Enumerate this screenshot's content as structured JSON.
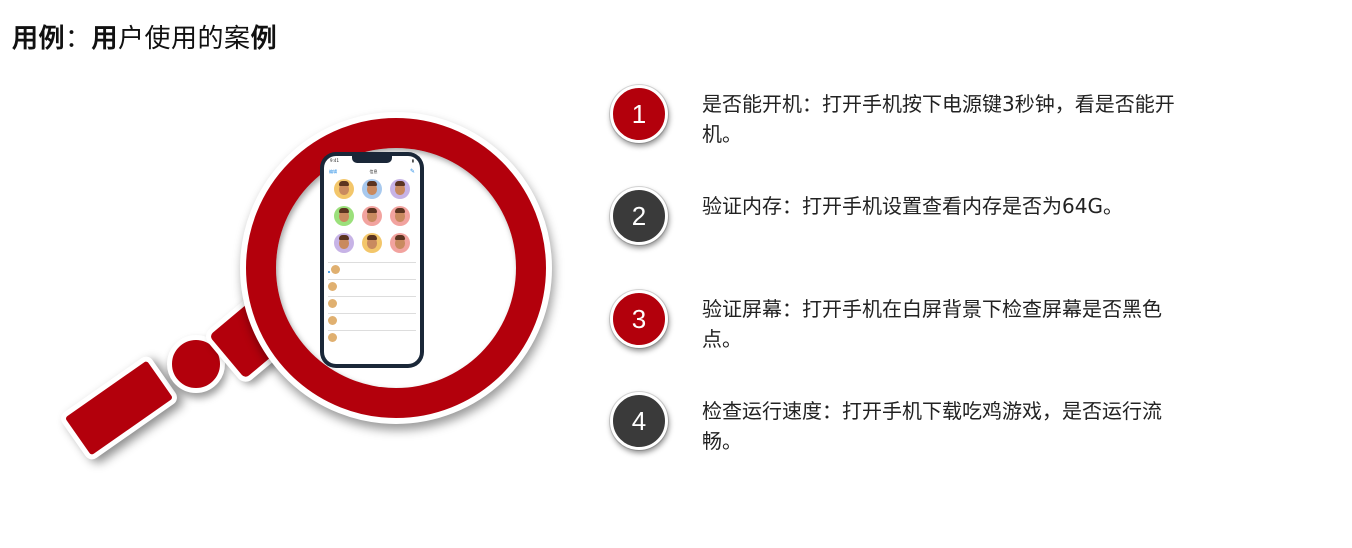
{
  "title": {
    "part1": "用例",
    "colon": "：",
    "part2": "用",
    "part3": "户使用的案",
    "part4": "例"
  },
  "phone": {
    "status_time": "9:41",
    "nav_edit": "编辑",
    "nav_title": "信息",
    "nav_compose": "✎",
    "pinned": [
      {
        "name": "",
        "bg": "#f3c66a"
      },
      {
        "name": "",
        "bg": "#a8c9ee"
      },
      {
        "name": "",
        "bg": "#c7b3e6"
      },
      {
        "name": "",
        "bg": "#9be07b"
      },
      {
        "name": "",
        "bg": "#f2a39f"
      },
      {
        "name": "",
        "bg": "#f2a39f"
      },
      {
        "name": "",
        "bg": "#c7b3e6"
      },
      {
        "name": "",
        "bg": "#f3c66a"
      },
      {
        "name": "",
        "bg": "#f2a39f"
      }
    ],
    "messages": [
      {
        "name": "",
        "time": "",
        "text": ""
      },
      {
        "name": "",
        "time": "",
        "text": ""
      },
      {
        "name": "",
        "time": "",
        "text": ""
      },
      {
        "name": "",
        "time": "",
        "text": ""
      },
      {
        "name": "",
        "time": "",
        "text": ""
      }
    ]
  },
  "steps": [
    {
      "num": "1",
      "text": "是否能开机：打开手机按下电源键3秒钟，看是否能开机。",
      "color": "red"
    },
    {
      "num": "2",
      "text": "验证内存：打开手机设置查看内存是否为64G。",
      "color": "dark"
    },
    {
      "num": "3",
      "text": "验证屏幕：打开手机在白屏背景下检查屏幕是否黑色点。",
      "color": "red"
    },
    {
      "num": "4",
      "text": "检查运行速度：打开手机下载吃鸡游戏，是否运行流畅。",
      "color": "dark"
    }
  ],
  "colors": {
    "accent_red": "#b3000c",
    "dark_badge": "#3a3a3a"
  }
}
